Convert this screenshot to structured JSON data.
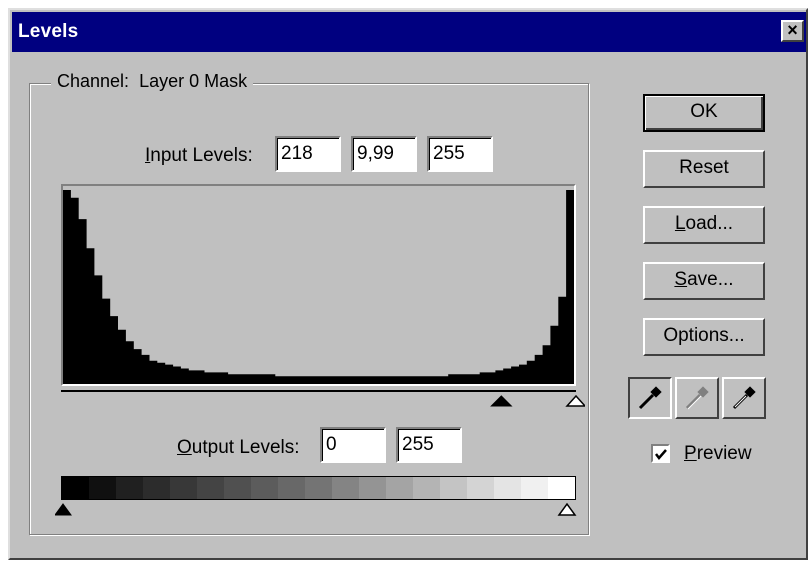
{
  "window": {
    "title": "Levels",
    "close_glyph": "×"
  },
  "channel": {
    "label": "Channel:",
    "value": "Layer 0 Mask"
  },
  "input_levels": {
    "label_underline": "I",
    "label_rest": "nput Levels:",
    "black": "218",
    "gamma": "9,99",
    "white": "255"
  },
  "output_levels": {
    "label_underline": "O",
    "label_rest": "utput Levels:",
    "black": "0",
    "white": "255"
  },
  "histogram": {
    "counts": [
      100,
      96,
      85,
      70,
      56,
      44,
      35,
      28,
      22,
      18,
      15,
      12,
      11,
      10,
      9,
      8,
      7,
      7,
      6,
      6,
      6,
      5,
      5,
      5,
      5,
      5,
      5,
      4,
      4,
      4,
      4,
      4,
      4,
      4,
      4,
      4,
      4,
      4,
      4,
      4,
      4,
      4,
      4,
      4,
      4,
      4,
      4,
      4,
      4,
      5,
      5,
      5,
      5,
      6,
      6,
      7,
      8,
      9,
      10,
      12,
      15,
      20,
      30,
      45,
      100
    ],
    "gamma_slider_level": 0.855,
    "white_slider_level": 1.0,
    "input_black_slider_level": 0.0
  },
  "gradient": {
    "shades": [
      "#000000",
      "#101010",
      "#202020",
      "#2c2c2c",
      "#383838",
      "#444444",
      "#505050",
      "#5c5c5c",
      "#686868",
      "#747474",
      "#848484",
      "#949494",
      "#a4a4a4",
      "#b4b4b4",
      "#c4c4c4",
      "#d4d4d4",
      "#e4e4e4",
      "#f0f0f0",
      "#ffffff"
    ]
  },
  "buttons": {
    "ok": "OK",
    "reset": "Reset",
    "load_underline": "L",
    "load_rest": "oad...",
    "save_underline": "S",
    "save_rest": "ave...",
    "options": "Options..."
  },
  "eyedroppers": [
    {
      "name": "black-eyedropper-icon",
      "color": "#000000",
      "pressed": true
    },
    {
      "name": "gray-eyedropper-icon",
      "color": "#808080",
      "pressed": false
    },
    {
      "name": "white-eyedropper-icon",
      "color": "#ffffff",
      "pressed": false
    }
  ],
  "preview": {
    "checked": true,
    "label_underline": "P",
    "label_rest": "review"
  },
  "colors": {
    "title_bar": "#000080",
    "dialog_face": "#c0c0c0",
    "histogram_fill": "#000000"
  }
}
